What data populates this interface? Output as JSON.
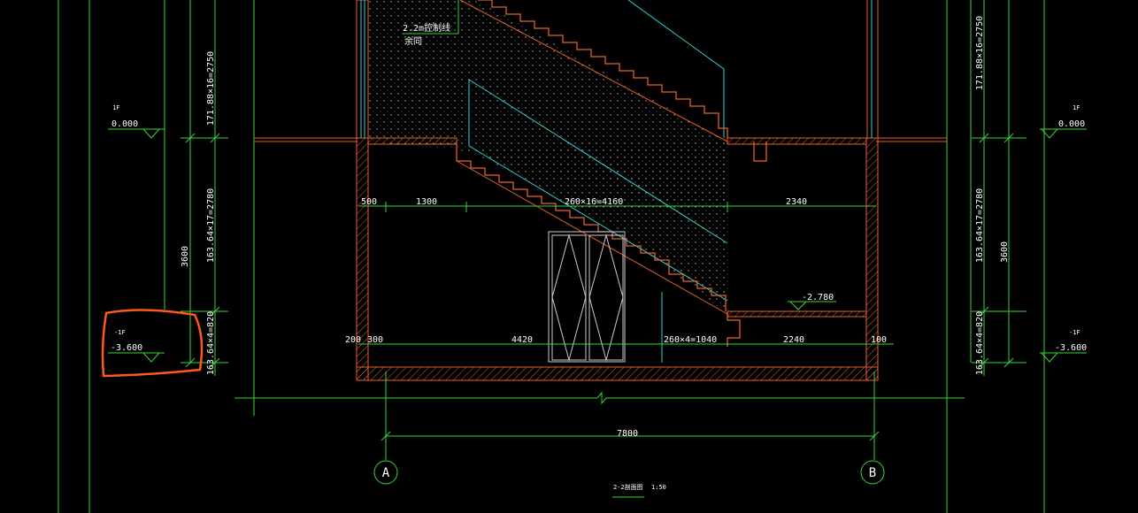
{
  "drawing": {
    "section_title": "2-2剖面图",
    "scale": "1:50",
    "colors": {
      "background": "#000000",
      "wall": "#e8602c",
      "dimension": "#39d439",
      "cyan": "#2fd3d3",
      "text": "#ffffff",
      "highlight": "#ff5a1e"
    }
  },
  "annotations": {
    "control_line": "2.2m控制线",
    "remark": "余同"
  },
  "levels": {
    "left_1f_label": "1F",
    "left_1f_value": "0.000",
    "left_b1_label": "-1F",
    "left_b1_value": "-3.600",
    "right_1f_label": "1F",
    "right_1f_value": "0.000",
    "right_b1_label": "-1F",
    "right_b1_value": "-3.600",
    "landing_value": "-2.780"
  },
  "vertical_dims": {
    "left_top": "171.88×16=2750",
    "left_mid": "163.64×17=2780",
    "left_bottom": "163.64×4=820",
    "left_total": "3600",
    "right_top": "171.88×16=2750",
    "right_mid": "163.64×17=2780",
    "right_bottom": "163.64×4=820",
    "right_total": "3600"
  },
  "horizontal_dims": {
    "upper": [
      "500",
      "1300",
      "260×16=4160",
      "2340"
    ],
    "lower": [
      "200",
      "300",
      "4420",
      "260×4=1040",
      "2240",
      "100"
    ],
    "overall": "7800"
  },
  "axes": [
    "A",
    "B"
  ],
  "icons": [
    "elevation-marker-icon",
    "door-icon",
    "break-line-icon",
    "axis-bubble-icon"
  ]
}
